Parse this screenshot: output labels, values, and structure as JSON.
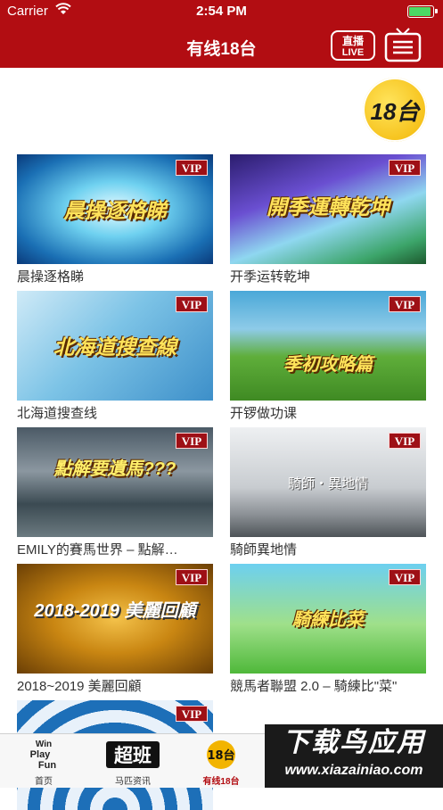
{
  "status_bar": {
    "carrier": "Carrier",
    "time": "2:54 PM"
  },
  "nav": {
    "title": "有线18台",
    "live_line1": "直播",
    "live_line2": "LIVE"
  },
  "channel_logo": {
    "text": "18台"
  },
  "programs": [
    {
      "caption": "晨操逐格睇",
      "overlay": "晨操逐格睇",
      "badge": "VIP"
    },
    {
      "caption": "开季运转乾坤",
      "overlay": "開季運轉乾坤",
      "badge": "VIP"
    },
    {
      "caption": "北海道搜查线",
      "overlay": "北海道搜查線",
      "badge": "VIP"
    },
    {
      "caption": "开锣做功课",
      "overlay": "季初攻略篇",
      "badge": "VIP"
    },
    {
      "caption": "EMILY的賽馬世界 – 點解…",
      "overlay": "點解要遺馬???",
      "badge": "VIP"
    },
    {
      "caption": "騎師異地情",
      "overlay": "騎師・異地情",
      "badge": "VIP"
    },
    {
      "caption": "2018~2019 美麗回顧",
      "overlay": "2018-2019 美麗回顧",
      "badge": "VIP"
    },
    {
      "caption": "競馬者聯盟 2.0 – 騎練比\"菜\"",
      "overlay": "騎練比菜",
      "badge": "VIP"
    },
    {
      "caption": "",
      "overlay": "",
      "badge": "VIP"
    }
  ],
  "tabs": [
    {
      "label": "首页",
      "icon_text": "Win Play Fun"
    },
    {
      "label": "马匹资讯",
      "icon_text": "超班"
    },
    {
      "label": "有线18台",
      "icon_text": "18台"
    }
  ],
  "watermark": {
    "line1": "下载鸟应用",
    "line2": "www.xiazainiao.com"
  },
  "colors": {
    "brand_red": "#b20d12",
    "vip_red": "#9e1016",
    "logo_yellow": "#f2b400"
  }
}
